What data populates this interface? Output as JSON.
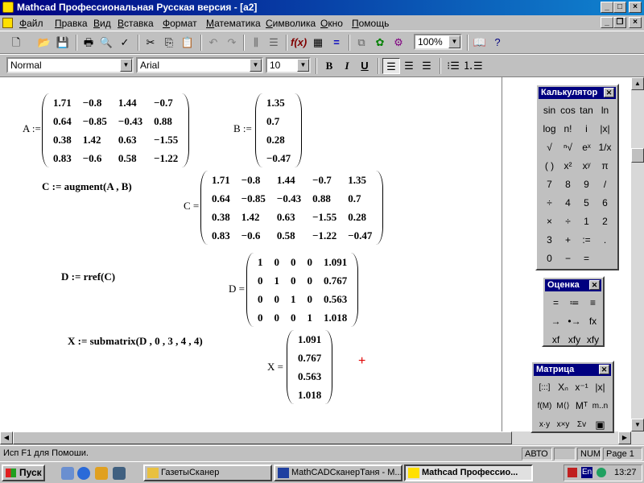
{
  "window": {
    "title": "Mathcad Профессиональная Русская версия - [a2]",
    "buttons": {
      "minimize": "_",
      "maximize": "□",
      "close": "×"
    }
  },
  "menu": {
    "items": [
      {
        "pre": "",
        "u": "Ф",
        "post": "айл"
      },
      {
        "pre": "",
        "u": "П",
        "post": "равка"
      },
      {
        "pre": "",
        "u": "В",
        "post": "ид"
      },
      {
        "pre": "",
        "u": "В",
        "post": "ставка"
      },
      {
        "pre": "",
        "u": "Ф",
        "post": "ормат"
      },
      {
        "pre": "",
        "u": "М",
        "post": "атематика"
      },
      {
        "pre": "",
        "u": "С",
        "post": "имволика"
      },
      {
        "pre": "",
        "u": "О",
        "post": "кно"
      },
      {
        "pre": "",
        "u": "П",
        "post": "омощь"
      }
    ]
  },
  "toolbar": {
    "zoom": "100%"
  },
  "format_bar": {
    "style": "Normal",
    "font": "Arial",
    "size": "10",
    "bold": "B",
    "italic": "I",
    "underline": "U"
  },
  "worksheet": {
    "A_label": "A :=",
    "A": [
      [
        "1.71",
        "−0.8",
        "1.44",
        "−0.7"
      ],
      [
        "0.64",
        "−0.85",
        "−0.43",
        "0.88"
      ],
      [
        "0.38",
        "1.42",
        "0.63",
        "−1.55"
      ],
      [
        "0.83",
        "−0.6",
        "0.58",
        "−1.22"
      ]
    ],
    "B_label": "B :=",
    "B": [
      [
        "1.35"
      ],
      [
        "0.7"
      ],
      [
        "0.28"
      ],
      [
        "−0.47"
      ]
    ],
    "C_def": "C := augment(A , B)",
    "C_label": "C =",
    "C": [
      [
        "1.71",
        "−0.8",
        "1.44",
        "−0.7",
        "1.35"
      ],
      [
        "0.64",
        "−0.85",
        "−0.43",
        "0.88",
        "0.7"
      ],
      [
        "0.38",
        "1.42",
        "0.63",
        "−1.55",
        "0.28"
      ],
      [
        "0.83",
        "−0.6",
        "0.58",
        "−1.22",
        "−0.47"
      ]
    ],
    "D_def": "D := rref(C)",
    "D_label": "D =",
    "D": [
      [
        "1",
        "0",
        "0",
        "0",
        "1.091"
      ],
      [
        "0",
        "1",
        "0",
        "0",
        "0.767"
      ],
      [
        "0",
        "0",
        "1",
        "0",
        "0.563"
      ],
      [
        "0",
        "0",
        "0",
        "1",
        "1.018"
      ]
    ],
    "X_def": "X := submatrix(D , 0 , 3 , 4 , 4)",
    "X_label": "X =",
    "X": [
      [
        "1.091"
      ],
      [
        "0.767"
      ],
      [
        "0.563"
      ],
      [
        "1.018"
      ]
    ],
    "cursor": "+"
  },
  "palettes": {
    "calculator": {
      "title": "Калькулятор",
      "cells": [
        "sin",
        "cos",
        "tan",
        "ln",
        "log",
        "n!",
        "i",
        "|x|",
        "√",
        "ⁿ√",
        "eˣ",
        "1/x",
        "( )",
        "x²",
        "xʸ",
        "π",
        "7",
        "8",
        "9",
        "/",
        "÷",
        "4",
        "5",
        "6",
        "×",
        "÷",
        "1",
        "2",
        "3",
        "+",
        ":=",
        ".",
        "0",
        "−",
        "=",
        ""
      ]
    },
    "evaluation": {
      "title": "Оценка",
      "cells": [
        "=",
        "≔",
        "≡",
        "→",
        "•→",
        "fx",
        "xf",
        "xfy",
        "xfy"
      ]
    },
    "matrix": {
      "title": "Матрица",
      "cells": [
        "[:::]",
        "Xₙ",
        "x⁻¹",
        "|x|",
        "f(M)",
        "M⟨⟩",
        "Mᵀ",
        "m..n",
        "x·y",
        "x×y",
        "Σv",
        ""
      ]
    }
  },
  "status": {
    "help": "Исп F1 для Помоши.",
    "mode": "АВТО",
    "blank": "",
    "num": "NUM",
    "page": "Page 1"
  },
  "taskbar": {
    "start": "Пуск",
    "tasks": [
      {
        "label": "ГазетыСканер"
      },
      {
        "label": "MathCADСканерТаня - M..."
      },
      {
        "label": "Mathcad Профессио..."
      }
    ],
    "lang": "En",
    "clock": "13:27"
  }
}
